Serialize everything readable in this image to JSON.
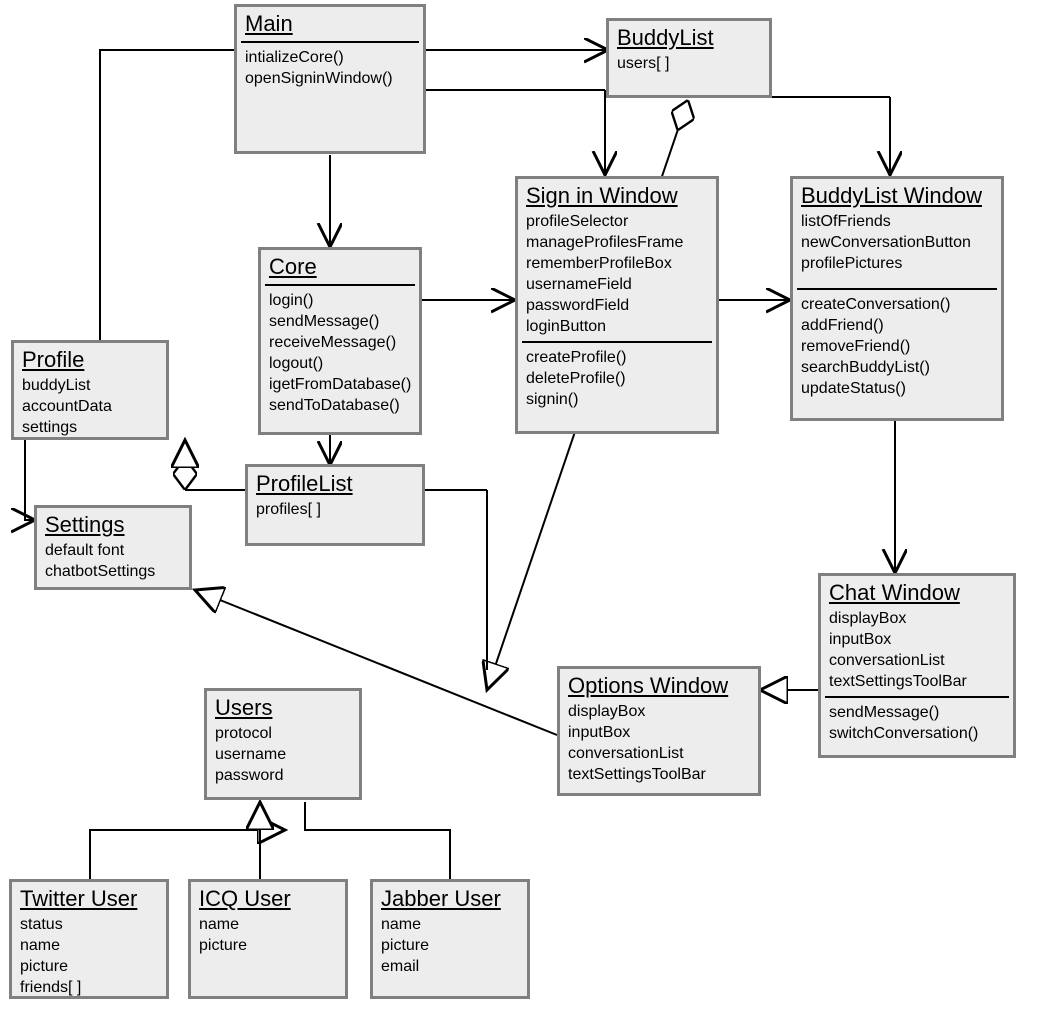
{
  "classes": {
    "main": {
      "title": "Main",
      "methods": [
        "intializeCore()",
        "openSigninWindow()"
      ]
    },
    "buddylist": {
      "title": "BuddyList",
      "attrs": [
        "users[ ]"
      ]
    },
    "core": {
      "title": "Core",
      "methods": [
        "login()",
        "sendMessage()",
        "receiveMessage()",
        "logout()",
        "igetFromDatabase()",
        "sendToDatabase()"
      ]
    },
    "profile": {
      "title": "Profile",
      "attrs": [
        "buddyList",
        "accountData",
        "settings"
      ]
    },
    "signin": {
      "title": "Sign in Window",
      "attrs": [
        "profileSelector",
        "manageProfilesFrame",
        "rememberProfileBox",
        "usernameField",
        "passwordField",
        "loginButton"
      ],
      "methods": [
        "createProfile()",
        "deleteProfile()",
        "signin()"
      ]
    },
    "buddylistwindow": {
      "title": "BuddyList Window",
      "attrs": [
        "listOfFriends",
        "newConversationButton",
        "profilePictures"
      ],
      "methods": [
        "createConversation()",
        "addFriend()",
        "removeFriend()",
        "searchBuddyList()",
        "updateStatus()"
      ]
    },
    "profilelist": {
      "title": "ProfileList",
      "attrs": [
        "profiles[ ]"
      ]
    },
    "settings": {
      "title": "Settings",
      "attrs": [
        "default font",
        "chatbotSettings"
      ]
    },
    "chatwindow": {
      "title": "Chat Window",
      "attrs": [
        "displayBox",
        "inputBox",
        "conversationList",
        "textSettingsToolBar"
      ],
      "methods": [
        "sendMessage()",
        "switchConversation()"
      ]
    },
    "optionswindow": {
      "title": "Options Window",
      "attrs": [
        "displayBox",
        "inputBox",
        "conversationList",
        "textSettingsToolBar"
      ]
    },
    "users": {
      "title": "Users",
      "attrs": [
        "protocol",
        "username",
        "password"
      ]
    },
    "twitter": {
      "title": "Twitter User",
      "attrs": [
        "status",
        "name",
        "picture",
        "friends[ ]"
      ]
    },
    "icq": {
      "title": "ICQ User",
      "attrs": [
        "name",
        "picture"
      ]
    },
    "jabber": {
      "title": "Jabber User",
      "attrs": [
        "name",
        "picture",
        "email"
      ]
    }
  }
}
